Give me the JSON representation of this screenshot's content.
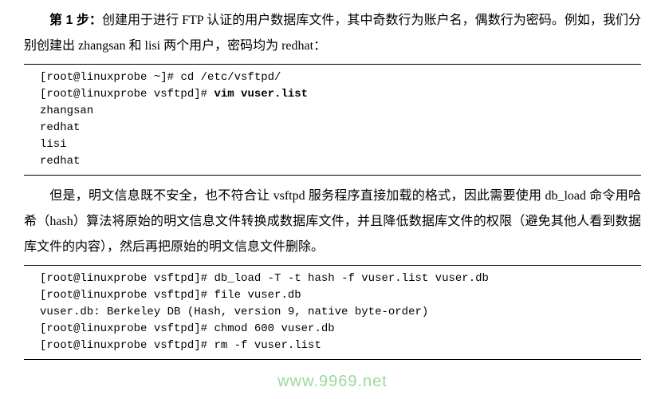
{
  "para1": {
    "step_label": "第 1 步：",
    "text_a": "创建用于进行 FTP 认证的用户数据库文件，其中奇数行为账户名，偶数行为密码。例如，我们分别创建出 zhangsan 和 lisi 两个用户，密码均为 redhat："
  },
  "code1": {
    "line1_prompt": "[root@linuxprobe ~]# ",
    "line1_cmd": "cd /etc/vsftpd/",
    "line2_prompt": "[root@linuxprobe vsftpd]# ",
    "line2_cmd": "vim vuser.list",
    "line3": "zhangsan",
    "line4": "redhat",
    "line5": "lisi",
    "line6": "redhat"
  },
  "para2": {
    "text": "但是，明文信息既不安全，也不符合让 vsftpd 服务程序直接加载的格式，因此需要使用 db_load 命令用哈希（hash）算法将原始的明文信息文件转换成数据库文件，并且降低数据库文件的权限（避免其他人看到数据库文件的内容），然后再把原始的明文信息文件删除。"
  },
  "code2": {
    "line1_prompt": "[root@linuxprobe vsftpd]# ",
    "line1_cmd": "db_load -T -t hash -f vuser.list vuser.db",
    "line2_prompt": "[root@linuxprobe vsftpd]# ",
    "line2_cmd": "file vuser.db",
    "line3": "vuser.db: Berkeley DB (Hash, version 9, native byte-order)",
    "line4_prompt": "[root@linuxprobe vsftpd]# ",
    "line4_cmd": "chmod 600 vuser.db",
    "line5_prompt": "[root@linuxprobe vsftpd]# ",
    "line5_cmd": "rm -f vuser.list"
  },
  "watermark": "www.9969.net"
}
